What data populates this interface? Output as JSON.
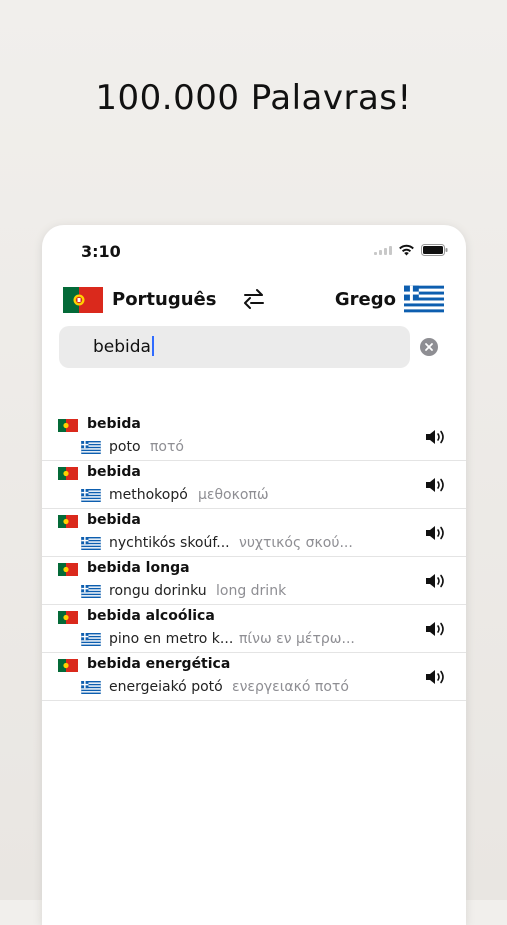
{
  "headline": "100.000 Palavras!",
  "status_bar": {
    "time": "3:10",
    "icons": [
      "signal-icon",
      "wifi-icon",
      "battery-icon"
    ]
  },
  "language_bar": {
    "source_language": "Português",
    "target_language": "Grego",
    "source_flag": "portugal-flag-icon",
    "target_flag": "greece-flag-icon",
    "swap_icon": "swap-arrows-icon"
  },
  "search": {
    "value": "bebida",
    "clear_icon": "clear-icon"
  },
  "results": [
    {
      "word": "bebida",
      "translit": "poto",
      "greek": "ποτό"
    },
    {
      "word": "bebida",
      "translit": "methokopó",
      "greek": "μεθοκοπώ"
    },
    {
      "word": "bebida",
      "translit": "nychtikós skoúf...",
      "greek": "νυχτικός σκού..."
    },
    {
      "word": "bebida longa",
      "translit": "rongu dorinku",
      "greek": "long drink"
    },
    {
      "word": "bebida alcoólica",
      "translit": "pino en metro k...",
      "greek": "πίνω εν μέτρω..."
    },
    {
      "word": "bebida energética",
      "translit": "energeiakó potó",
      "greek": "ενεργειακό ποτό"
    }
  ],
  "colors": {
    "accent": "#2f6bff",
    "secondary_text": "#8e8e93",
    "pt_green": "#046a38",
    "pt_red": "#da291c",
    "gr_blue": "#0d5eaf"
  }
}
